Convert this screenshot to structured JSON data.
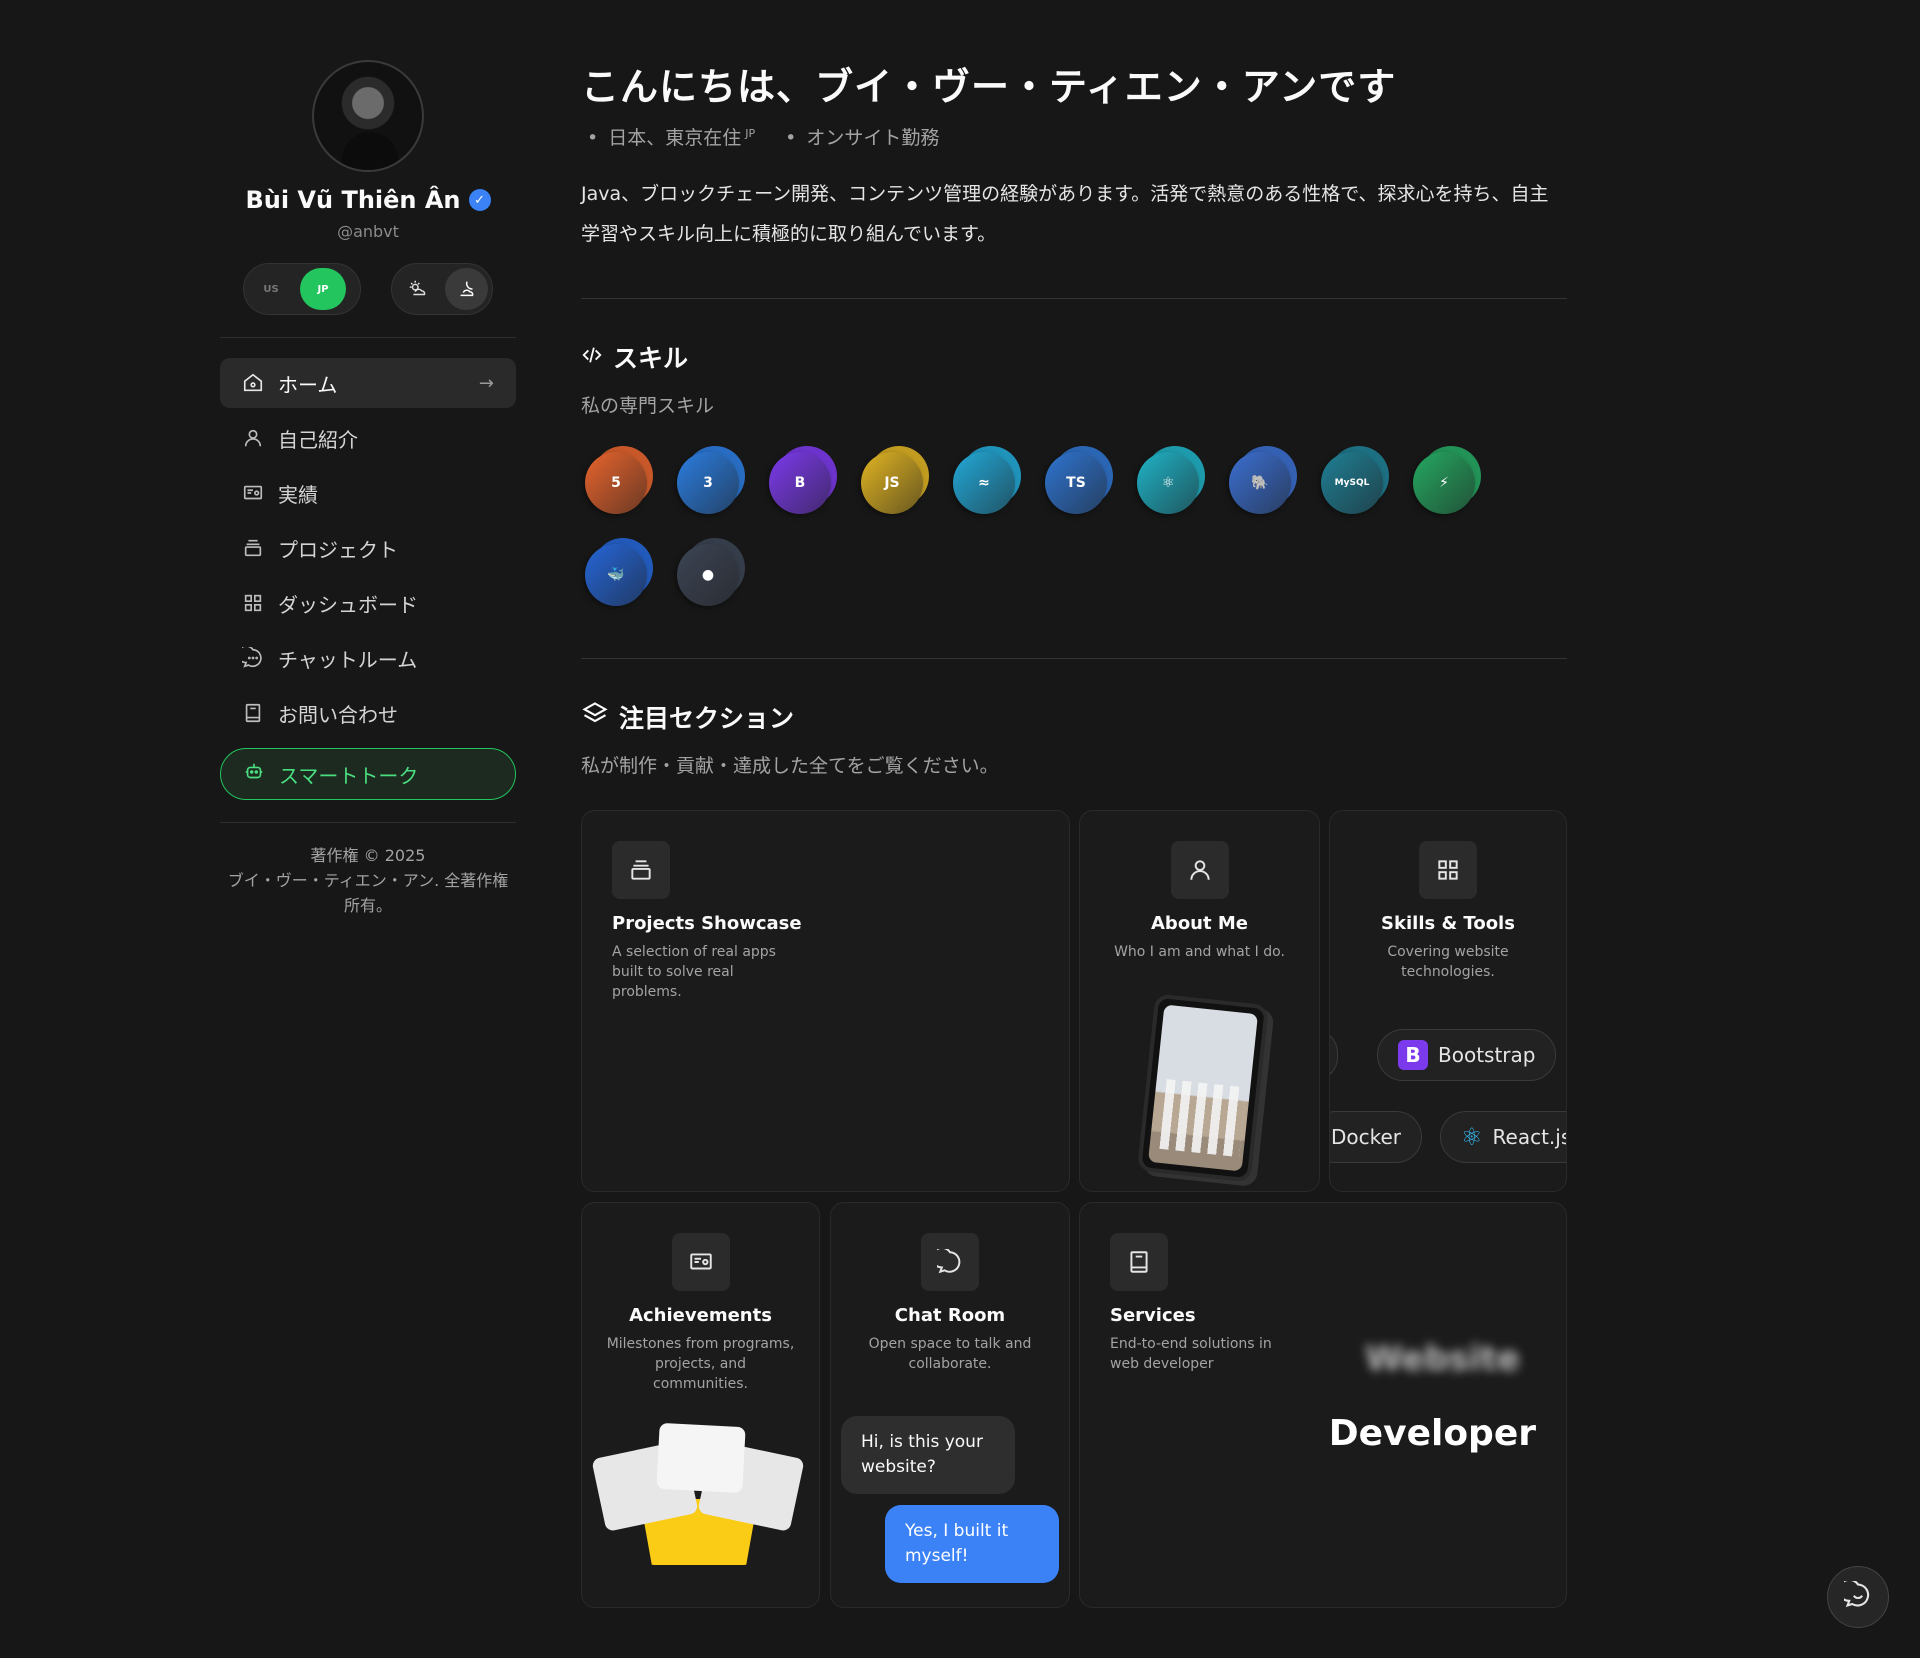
{
  "profile": {
    "name": "Bùi Vũ Thiên Ân",
    "handle": "@anbvt",
    "lang_toggle": {
      "us": "US",
      "jp": "JP"
    }
  },
  "nav": [
    {
      "label": "ホーム",
      "icon": "home-icon",
      "active": true
    },
    {
      "label": "自己紹介",
      "icon": "user-icon"
    },
    {
      "label": "実績",
      "icon": "certificate-icon"
    },
    {
      "label": "プロジェクト",
      "icon": "stack-icon"
    },
    {
      "label": "ダッシュボード",
      "icon": "dashboard-icon"
    },
    {
      "label": "チャットルーム",
      "icon": "chat-icon"
    },
    {
      "label": "お問い合わせ",
      "icon": "book-icon"
    }
  ],
  "smart_talk": "スマートトーク",
  "copyright": {
    "line1": "著作権 © 2025",
    "line2": "ブイ・ヴー・ティエン・アン. 全著作権所有。"
  },
  "hero": {
    "title": "こんにちは、ブイ・ヴー・ティエン・アンです",
    "location": "日本、東京在住",
    "location_tag": "JP",
    "work": "オンサイト勤務",
    "bio": "Java、ブロックチェーン開発、コンテンツ管理の経験があります。活発で熱意のある性格で、探求心を持ち、自主学習やスキル向上に積極的に取り組んでいます。"
  },
  "skills_section": {
    "title": "スキル",
    "subtitle": "私の専門スキル",
    "items": [
      {
        "name": "HTML5",
        "glyph": "5",
        "color": "#e8642d"
      },
      {
        "name": "CSS3",
        "glyph": "3",
        "color": "#2b7de0"
      },
      {
        "name": "Bootstrap",
        "glyph": "B",
        "color": "#7c3aed"
      },
      {
        "name": "JavaScript",
        "glyph": "JS",
        "color": "#e0b422"
      },
      {
        "name": "Tailwind CSS",
        "glyph": "≈",
        "color": "#22a9d8"
      },
      {
        "name": "TypeScript",
        "glyph": "TS",
        "color": "#2f74d0"
      },
      {
        "name": "React",
        "glyph": "⚛",
        "color": "#1fb3c7"
      },
      {
        "name": "PostgreSQL",
        "glyph": "🐘",
        "color": "#3b6fd1"
      },
      {
        "name": "MySQL",
        "glyph": "MySQL",
        "color": "#1f7f95"
      },
      {
        "name": "Supabase",
        "glyph": "⚡",
        "color": "#25a861"
      },
      {
        "name": "Docker",
        "glyph": "🐳",
        "color": "#2566d8"
      },
      {
        "name": "GitHub",
        "glyph": "●",
        "color": "#3c4454"
      }
    ]
  },
  "featured": {
    "title": "注目セクション",
    "subtitle": "私が制作・貢献・達成した全てをご覧ください。",
    "cards": {
      "projects": {
        "title": "Projects Showcase",
        "desc": "A selection of real apps built to solve real problems."
      },
      "about": {
        "title": "About Me",
        "desc": "Who I am and what I do."
      },
      "skills": {
        "title": "Skills & Tools",
        "desc": "Covering website technologies.",
        "pills": [
          "Bootstrap",
          "Docker",
          "React.js"
        ]
      },
      "achievements": {
        "title": "Achievements",
        "desc": "Milestones from programs, projects, and communities."
      },
      "chat": {
        "title": "Chat Room",
        "desc": "Open space to talk and collaborate.",
        "msg_in": "Hi, is this your website?",
        "msg_out": "Yes, I built it myself!"
      },
      "services": {
        "title": "Services",
        "desc": "End-to-end solutions in web developer",
        "word_blur": "Website",
        "word_main": "Developer"
      }
    }
  }
}
